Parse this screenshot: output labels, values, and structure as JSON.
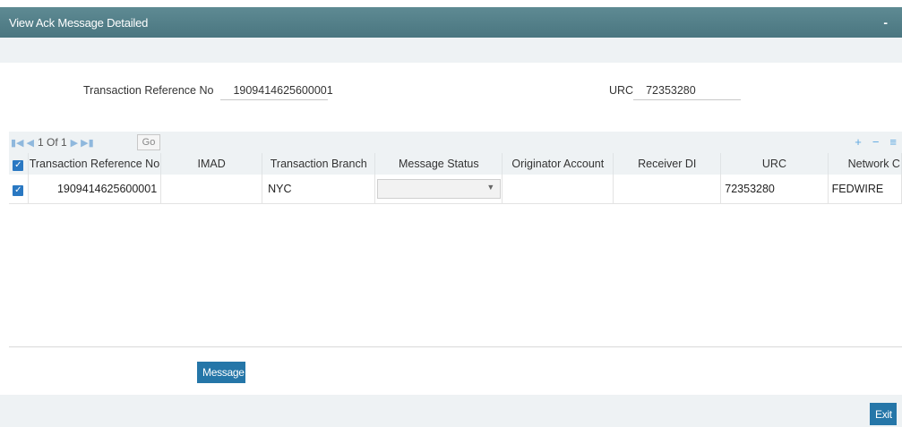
{
  "window": {
    "title": "View Ack Message Detailed",
    "minimize_glyph": "-"
  },
  "form": {
    "txn_ref_label": "Transaction Reference No",
    "txn_ref_value": "1909414625600001",
    "urc_label": "URC",
    "urc_value": "72353280"
  },
  "grid": {
    "pager": {
      "page_text": "1 Of 1",
      "go_label": "Go"
    },
    "columns": [
      "Transaction Reference No",
      "IMAD",
      "Transaction Branch",
      "Message Status",
      "Originator Account",
      "Receiver DI",
      "URC",
      "Network C"
    ],
    "rows": [
      {
        "txn_ref": "1909414625600001",
        "imad": "",
        "branch": "NYC",
        "status": "",
        "originator": "",
        "receiver": "",
        "urc": "72353280",
        "network": "FEDWIRE"
      }
    ]
  },
  "actions": {
    "message_label": "Message",
    "exit_label": "Exit"
  },
  "colors": {
    "accent": "#2576a8",
    "titlebar": "#4f7c86",
    "band": "#eef2f4",
    "checkbox": "#2a78c2"
  },
  "icons": [
    "first-page-icon",
    "prev-page-icon",
    "next-page-icon",
    "last-page-icon",
    "add-row-icon",
    "delete-row-icon",
    "column-settings-icon",
    "checkbox-checked-icon",
    "dropdown-arrow-icon"
  ]
}
